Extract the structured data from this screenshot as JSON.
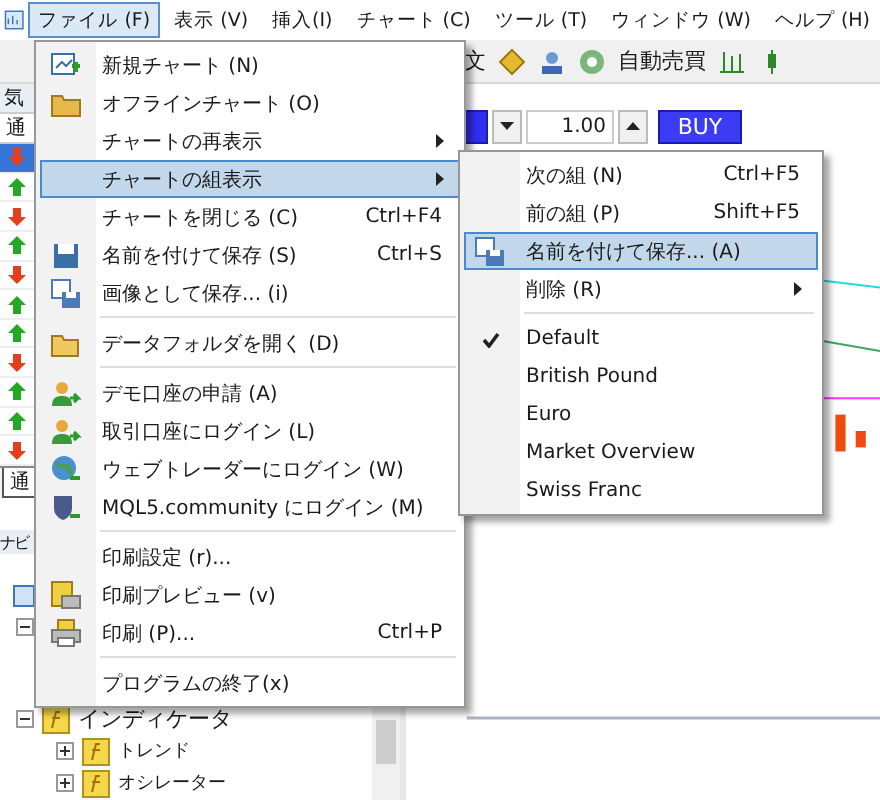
{
  "menubar": [
    {
      "label": "ファイル (F)",
      "selected": true
    },
    {
      "label": "表示 (V)",
      "selected": false
    },
    {
      "label": "挿入(I)",
      "selected": false
    },
    {
      "label": "チャート (C)",
      "selected": false
    },
    {
      "label": "ツール (T)",
      "selected": false
    },
    {
      "label": "ウィンドウ (W)",
      "selected": false
    },
    {
      "label": "ヘルプ (H)",
      "selected": false
    }
  ],
  "toolbar": {
    "order_label": "文",
    "auto_trading": "自動売買"
  },
  "market_watch": {
    "title": "気",
    "column": "通",
    "bottom_tab": "通",
    "rows": [
      {
        "kind": "down"
      },
      {
        "kind": "up"
      },
      {
        "kind": "down"
      },
      {
        "kind": "up"
      },
      {
        "kind": "down"
      },
      {
        "kind": "up"
      },
      {
        "kind": "up"
      },
      {
        "kind": "down"
      },
      {
        "kind": "up"
      },
      {
        "kind": "up"
      },
      {
        "kind": "down"
      }
    ]
  },
  "navigator": {
    "title": "ナビ",
    "tree": [
      {
        "expanded": true,
        "children": [
          {
            "expanded": true
          },
          {
            "label": "インディケータ",
            "expanded": true,
            "children": [
              {
                "label": "トレンド",
                "expanded": false
              },
              {
                "label": "オシレーター",
                "expanded": false
              }
            ]
          }
        ]
      }
    ]
  },
  "trade_panel": {
    "volume": "1.00",
    "buy": "BUY"
  },
  "file_menu": [
    {
      "kind": "item",
      "label": "新規チャート (N)",
      "selected": false
    },
    {
      "kind": "item",
      "label": "オフラインチャート (O)",
      "selected": false
    },
    {
      "kind": "item",
      "label": "チャートの再表示",
      "submenu": true,
      "selected": false
    },
    {
      "kind": "item",
      "label": "チャートの組表示",
      "submenu": true,
      "selected": true
    },
    {
      "kind": "item",
      "label": "チャートを閉じる (C)",
      "shortcut": "Ctrl+F4",
      "selected": false
    },
    {
      "kind": "item",
      "label": "名前を付けて保存 (S)",
      "shortcut": "Ctrl+S",
      "selected": false
    },
    {
      "kind": "item",
      "label": "画像として保存... (i)",
      "selected": false
    },
    {
      "kind": "separator"
    },
    {
      "kind": "item",
      "label": "データフォルダを開く (D)",
      "selected": false
    },
    {
      "kind": "separator"
    },
    {
      "kind": "item",
      "label": "デモ口座の申請 (A)",
      "selected": false
    },
    {
      "kind": "item",
      "label": "取引口座にログイン (L)",
      "selected": false
    },
    {
      "kind": "item",
      "label": "ウェブトレーダーにログイン (W)",
      "selected": false
    },
    {
      "kind": "item",
      "label": "MQL5.community にログイン (M)",
      "selected": false
    },
    {
      "kind": "separator"
    },
    {
      "kind": "item",
      "label": "印刷設定 (r)...",
      "selected": false
    },
    {
      "kind": "item",
      "label": "印刷プレビュー (v)",
      "selected": false
    },
    {
      "kind": "item",
      "label": "印刷 (P)...",
      "shortcut": "Ctrl+P",
      "selected": false
    },
    {
      "kind": "separator"
    },
    {
      "kind": "item",
      "label": "プログラムの終了(x)",
      "selected": false
    }
  ],
  "profiles_menu": [
    {
      "kind": "item",
      "label": "次の組 (N)",
      "shortcut": "Ctrl+F5",
      "selected": false
    },
    {
      "kind": "item",
      "label": "前の組 (P)",
      "shortcut": "Shift+F5",
      "selected": false
    },
    {
      "kind": "item",
      "label": "名前を付けて保存... (A)",
      "selected": true
    },
    {
      "kind": "item",
      "label": "削除 (R)",
      "submenu": true,
      "selected": false
    },
    {
      "kind": "separator"
    },
    {
      "kind": "item",
      "label": "Default",
      "checked": true,
      "selected": false
    },
    {
      "kind": "item",
      "label": "British Pound",
      "checked": false,
      "selected": false
    },
    {
      "kind": "item",
      "label": "Euro",
      "checked": false,
      "selected": false
    },
    {
      "kind": "item",
      "label": "Market Overview",
      "checked": false,
      "selected": false
    },
    {
      "kind": "item",
      "label": "Swiss Franc",
      "checked": false,
      "selected": false
    }
  ]
}
